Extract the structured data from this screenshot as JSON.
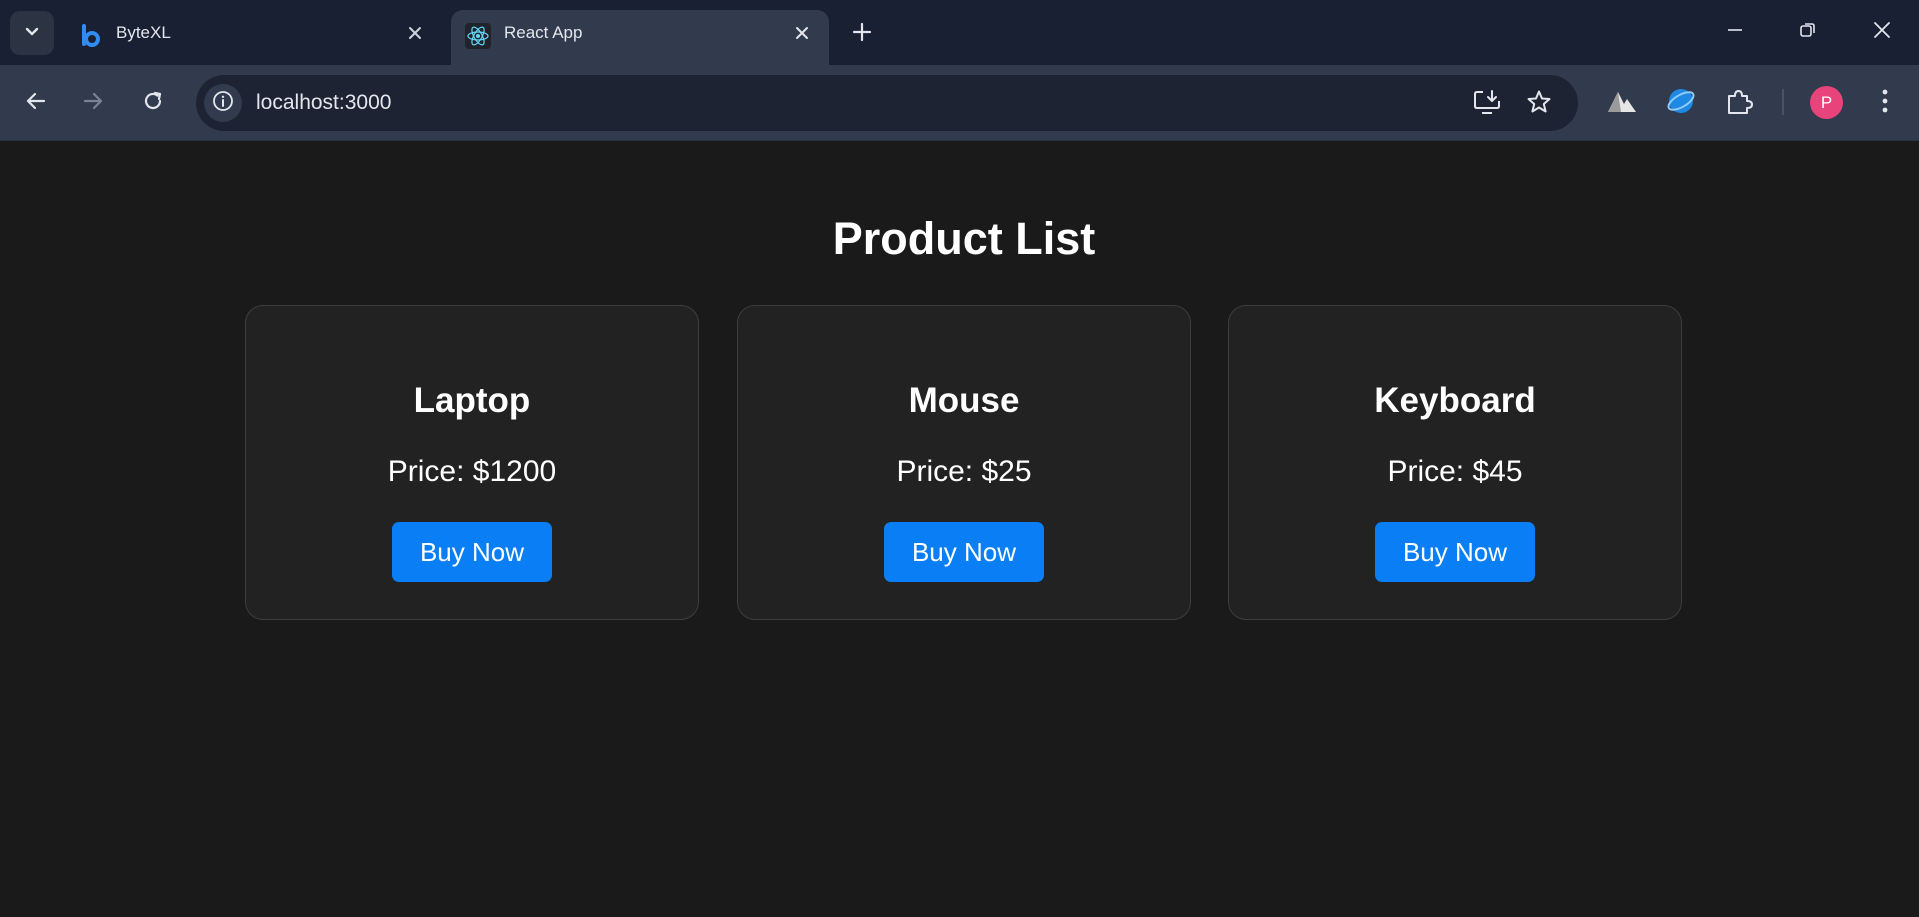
{
  "browser": {
    "tabs": [
      {
        "title": "ByteXL",
        "active": false,
        "favicon": "bytexl-logo-icon"
      },
      {
        "title": "React App",
        "active": true,
        "favicon": "react-logo-icon"
      }
    ],
    "address": "localhost:3000",
    "profile_initial": "P"
  },
  "colors": {
    "page_background": "#1a1a1a",
    "card_background": "#222222",
    "button": "#0a7ff5",
    "tab_strip": "#1a2033",
    "toolbar": "#323b4d",
    "avatar": "#e8437a"
  },
  "page": {
    "title": "Product List",
    "products": [
      {
        "name": "Laptop",
        "price": "Price: $1200",
        "button": "Buy Now"
      },
      {
        "name": "Mouse",
        "price": "Price: $25",
        "button": "Buy Now"
      },
      {
        "name": "Keyboard",
        "price": "Price: $45",
        "button": "Buy Now"
      }
    ]
  }
}
